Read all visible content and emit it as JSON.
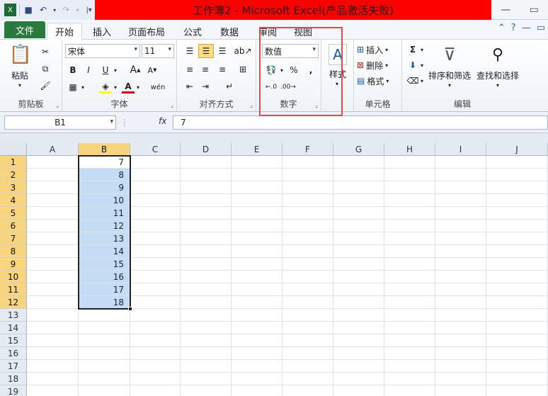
{
  "window": {
    "title": "工作簿2 - Microsoft Excel(产品激活失败)"
  },
  "tabs": [
    {
      "label": "文件"
    },
    {
      "label": "开始"
    },
    {
      "label": "插入"
    },
    {
      "label": "页面布局"
    },
    {
      "label": "公式"
    },
    {
      "label": "数据"
    },
    {
      "label": "审阅"
    },
    {
      "label": "视图"
    }
  ],
  "ribbon": {
    "clipboard": {
      "label": "剪贴板",
      "paste": "粘贴"
    },
    "font": {
      "label": "字体",
      "name": "宋体",
      "size": "11"
    },
    "alignment": {
      "label": "对齐方式"
    },
    "number": {
      "label": "数字",
      "format": "数值"
    },
    "styles": {
      "label": "样式"
    },
    "cells": {
      "label": "单元格",
      "insert": "插入",
      "delete": "删除",
      "format": "格式"
    },
    "editing": {
      "label": "编辑",
      "sort_filter": "排序和筛选",
      "find_select": "查找和选择"
    }
  },
  "formula_bar": {
    "name_box": "B1",
    "fx": "fx",
    "formula": "7"
  },
  "columns": [
    "A",
    "B",
    "C",
    "D",
    "E",
    "F",
    "G",
    "H",
    "I",
    "J"
  ],
  "rows": [
    "1",
    "2",
    "3",
    "4",
    "5",
    "6",
    "7",
    "8",
    "9",
    "10",
    "11",
    "12",
    "13",
    "14",
    "15",
    "16",
    "17",
    "18",
    "19"
  ],
  "column_b_values": [
    "7",
    "8",
    "9",
    "10",
    "11",
    "12",
    "13",
    "14",
    "15",
    "16",
    "17",
    "18"
  ],
  "colors": {
    "title_bar": "#ff0000",
    "file_tab": "#2b7a3d",
    "selection": "#c5dcf5",
    "header_highlight": "#f8d47c",
    "annotation": "#e34b4b"
  }
}
